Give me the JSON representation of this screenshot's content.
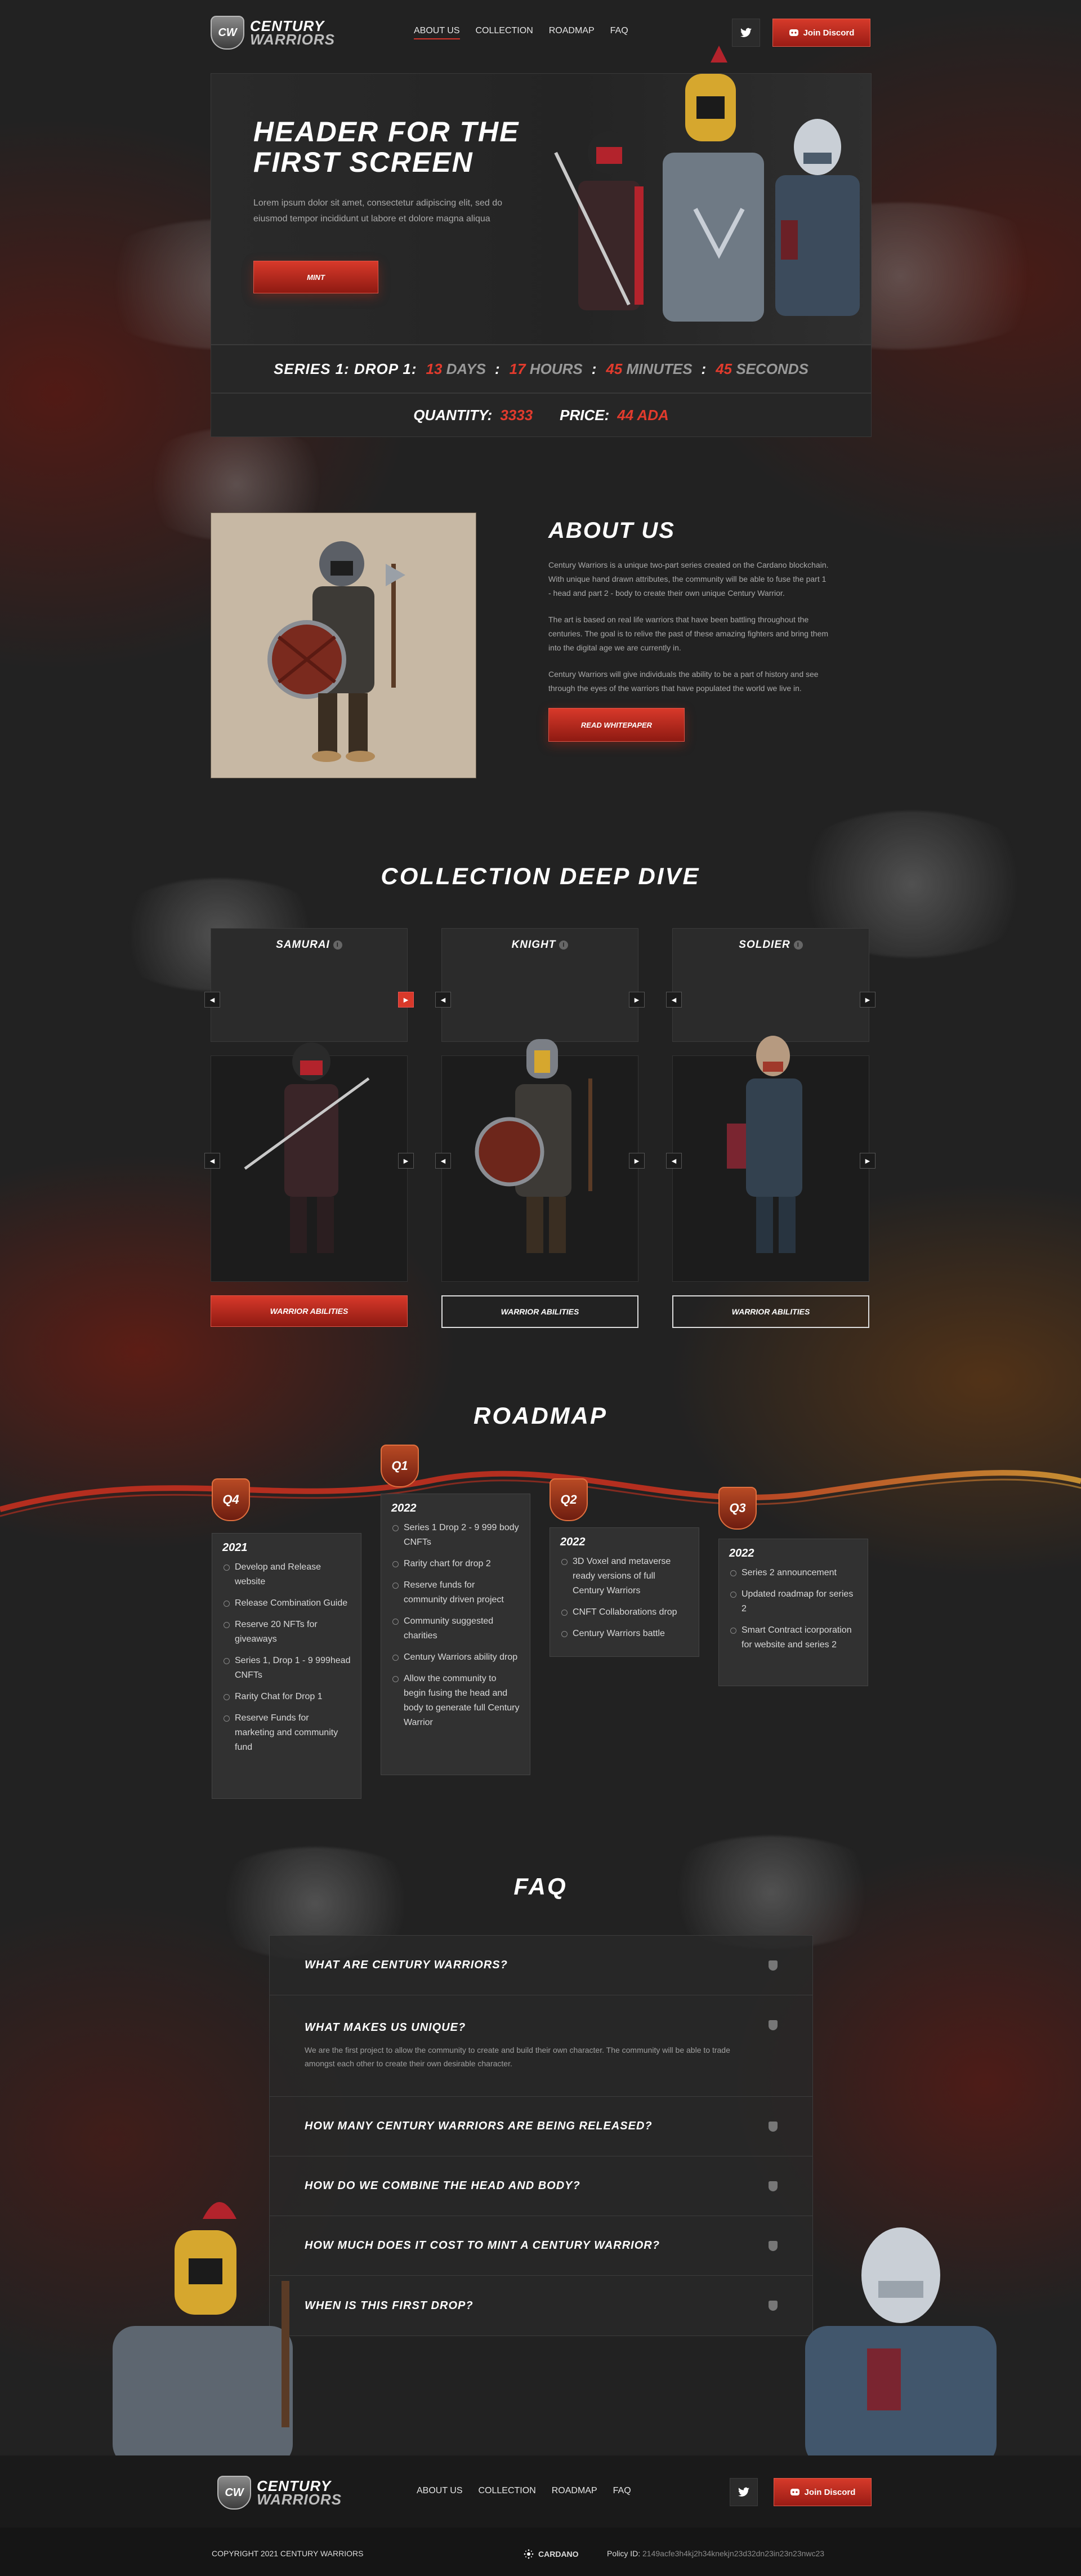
{
  "brand": {
    "line1": "CENTURY",
    "line2": "WARRIORS",
    "mark": "CW"
  },
  "nav": {
    "links": [
      {
        "label": "ABOUT US",
        "active": true
      },
      {
        "label": "COLLECTION"
      },
      {
        "label": "ROADMAP"
      },
      {
        "label": "FAQ"
      }
    ],
    "discord_label": "Join Discord"
  },
  "hero": {
    "title": "HEADER FOR THE FIRST SCREEN",
    "body": "Lorem ipsum dolor sit amet, consectetur adipiscing elit, sed do eiusmod tempor incididunt ut labore et dolore magna aliqua",
    "cta": "MINT"
  },
  "countdown": {
    "label": "SERIES 1: DROP 1:",
    "days": "13",
    "days_unit": "DAYS",
    "hours": "17",
    "hours_unit": "HOURS",
    "minutes": "45",
    "minutes_unit": "MINUTES",
    "seconds": "45",
    "seconds_unit": "SECONDS",
    "sep": ":"
  },
  "supply": {
    "qty_label": "QUANTITY:",
    "qty": "3333",
    "price_label": "PRICE:",
    "price": "44 ADA"
  },
  "about": {
    "title": "ABOUT US",
    "p1": "Century Warriors is a unique two-part series created on the Cardano blockchain. With unique hand drawn attributes, the community will be able to fuse the part 1 - head and part 2 - body to create their own unique Century Warrior.",
    "p2": "The art is based on real life warriors that have been battling throughout the centuries. The goal is to relive the past of these amazing fighters and bring them into the digital age we are currently in.",
    "p3": "Century Warriors will give individuals the ability to be a part of history and see through the eyes of the warriors that have populated the world we live in.",
    "cta": "READ WHITEPAPER"
  },
  "collection": {
    "title": "COLLECTION DEEP DIVE",
    "cards": [
      {
        "name": "SAMURAI",
        "button": "WARRIOR ABILITIES"
      },
      {
        "name": "KNIGHT",
        "button": "WARRIOR ABILITIES"
      },
      {
        "name": "SOLDIER",
        "button": "WARRIOR ABILITIES"
      }
    ],
    "info": "i",
    "arrow_left": "◀",
    "arrow_right": "▶"
  },
  "roadmap": {
    "title": "ROADMAP",
    "columns": [
      {
        "badge": "Q4",
        "year": "2021",
        "items": [
          "Develop and Release website",
          "Release Combination Guide",
          "Reserve 20 NFTs for giveaways",
          "Series 1, Drop 1 - 9 999head CNFTs",
          "Rarity Chat for Drop 1",
          "Reserve Funds for marketing and community fund"
        ]
      },
      {
        "badge": "Q1",
        "year": "2022",
        "items": [
          "Series 1 Drop 2 - 9 999 body CNFTs",
          "Rarity chart for drop 2",
          "Reserve funds for community driven project",
          "Community suggested charities",
          "Century Warriors ability drop",
          "Allow the community to begin fusing the head and body to generate full Century Warrior"
        ]
      },
      {
        "badge": "Q2",
        "year": "2022",
        "items": [
          "3D Voxel and metaverse ready versions of full Century Warriors",
          "CNFT Collaborations drop",
          "Century Warriors battle"
        ]
      },
      {
        "badge": "Q3",
        "year": "2022",
        "items": [
          "Series 2 announcement",
          "Updated roadmap for series 2",
          "Smart Contract icorporation for website and series 2"
        ]
      }
    ]
  },
  "faq": {
    "title": "FAQ",
    "items": [
      {
        "q": "WHAT ARE CENTURY WARRIORS?",
        "a": ""
      },
      {
        "q": "WHAT MAKES US UNIQUE?",
        "a": "We are the first project to allow the community to create and build their own character. The community will be able to trade amongst each other to create their own desirable character."
      },
      {
        "q": "HOW MANY CENTURY WARRIORS ARE BEING RELEASED?",
        "a": ""
      },
      {
        "q": "HOW DO WE COMBINE THE HEAD AND BODY?",
        "a": ""
      },
      {
        "q": "HOW MUCH DOES IT COST TO MINT A CENTURY WARRIOR?",
        "a": ""
      },
      {
        "q": "WHEN IS THIS FIRST DROP?",
        "a": ""
      }
    ]
  },
  "footer": {
    "copyright": "COPYRIGHT 2021 CENTURY WARRIORS",
    "cardano": "CARDANO",
    "policy_label": "Policy ID:",
    "policy_id": "2149acfe3h4kj2h34knekjn23d32dn23in23n23nwc23"
  },
  "colors": {
    "accent": "#d8392a",
    "bg": "#222222"
  },
  "icons": {
    "twitter": "twitter-icon",
    "discord": "discord-icon"
  }
}
